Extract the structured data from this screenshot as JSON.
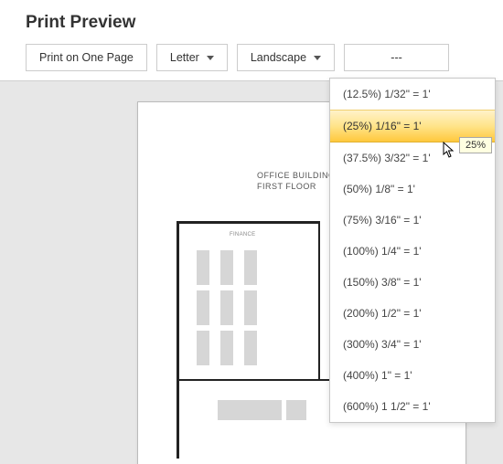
{
  "header": {
    "title": "Print Preview"
  },
  "toolbar": {
    "print_label": "Print on One Page",
    "paper_label": "Letter",
    "orientation_label": "Landscape",
    "scale_label": "---"
  },
  "preview": {
    "plan_title_line1": "OFFICE BUILDING",
    "plan_title_line2": "FIRST FLOOR",
    "room_label": "FINANCE"
  },
  "scale_dropdown": {
    "items": [
      "(12.5%) 1/32\" = 1'",
      "(25%) 1/16\" = 1'",
      "(37.5%) 3/32\" = 1'",
      "(50%) 1/8\" = 1'",
      "(75%) 3/16\" = 1'",
      "(100%) 1/4\" = 1'",
      "(150%) 3/8\" = 1'",
      "(200%) 1/2\" = 1'",
      "(300%) 3/4\" = 1'",
      "(400%) 1\" = 1'",
      "(600%) 1 1/2\" = 1'"
    ],
    "highlighted_index": 1
  },
  "tooltip": {
    "text": "25%"
  }
}
